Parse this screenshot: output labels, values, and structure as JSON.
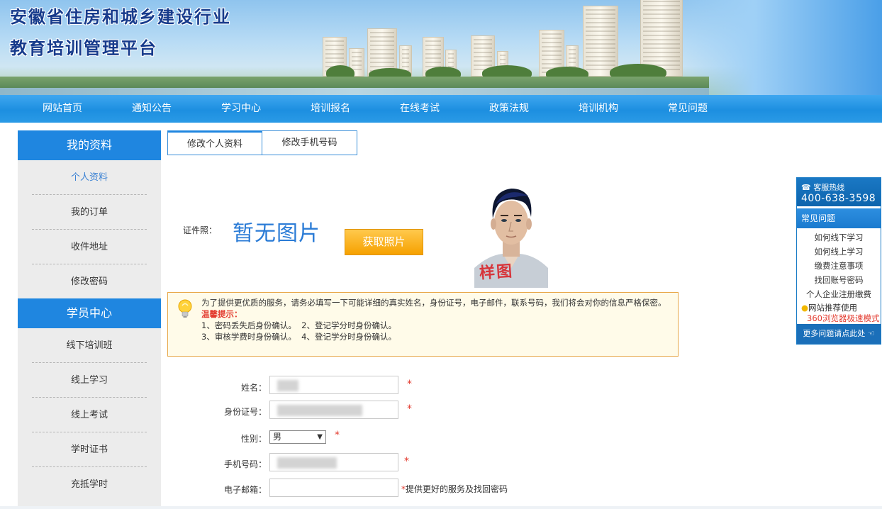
{
  "banner": {
    "title_line1": "安徽省住房和城乡建设行业",
    "title_line2": "教育培训管理平台"
  },
  "nav": {
    "items": [
      "网站首页",
      "通知公告",
      "学习中心",
      "培训报名",
      "在线考试",
      "政策法规",
      "培训机构",
      "常见问题"
    ]
  },
  "sidebar": {
    "section1_title": "我的资料",
    "section1_items": [
      "个人资料",
      "我的订单",
      "收件地址",
      "修改密码"
    ],
    "section2_title": "学员中心",
    "section2_items": [
      "线下培训班",
      "线上学习",
      "线上考试",
      "学时证书",
      "充抵学时"
    ]
  },
  "tabs": [
    "修改个人资料",
    "修改手机号码"
  ],
  "photo": {
    "label": "证件照：",
    "no_photo": "暂无图片",
    "get_button": "获取照片",
    "stamp": "样图"
  },
  "notice": {
    "main": "为了提供更优质的服务，请务必填写一下可能详细的真实姓名，身份证号，电子邮件，联系号码，我们将会对你的信息严格保密。",
    "tip_title": "温馨提示：",
    "tip_line1": "1、密码丢失后身份确认。  2、登记学分时身份确认。",
    "tip_line2": "3、审核学费时身份确认。  4、登记学分时身份确认。"
  },
  "form": {
    "name_label": "姓名：",
    "id_label": "身份证号：",
    "gender_label": "性别：",
    "gender_value": "男",
    "phone_label": "手机号码：",
    "email_label": "电子邮箱：",
    "required_mark": "*",
    "email_hint": "提供更好的服务及找回密码"
  },
  "right_float": {
    "hotline_label": "客服热线",
    "hotline_number": "400-638-3598",
    "faq_title": "常见问题",
    "faq_items": [
      "如何线下学习",
      "如何线上学习",
      "缴费注意事项",
      "找回账号密码",
      "个人企业注册缴费"
    ],
    "recommend_label": "网站推荐使用",
    "recommend_browser": "360浏览器极速模式",
    "more_link": "更多问题请点此处"
  },
  "colors": {
    "nav_blue": "#1d8fe0",
    "sidebar_head": "#1f86e0",
    "button_orange": "#f6a100",
    "required_red": "#e33a2e",
    "notice_border": "#e8a84a"
  }
}
